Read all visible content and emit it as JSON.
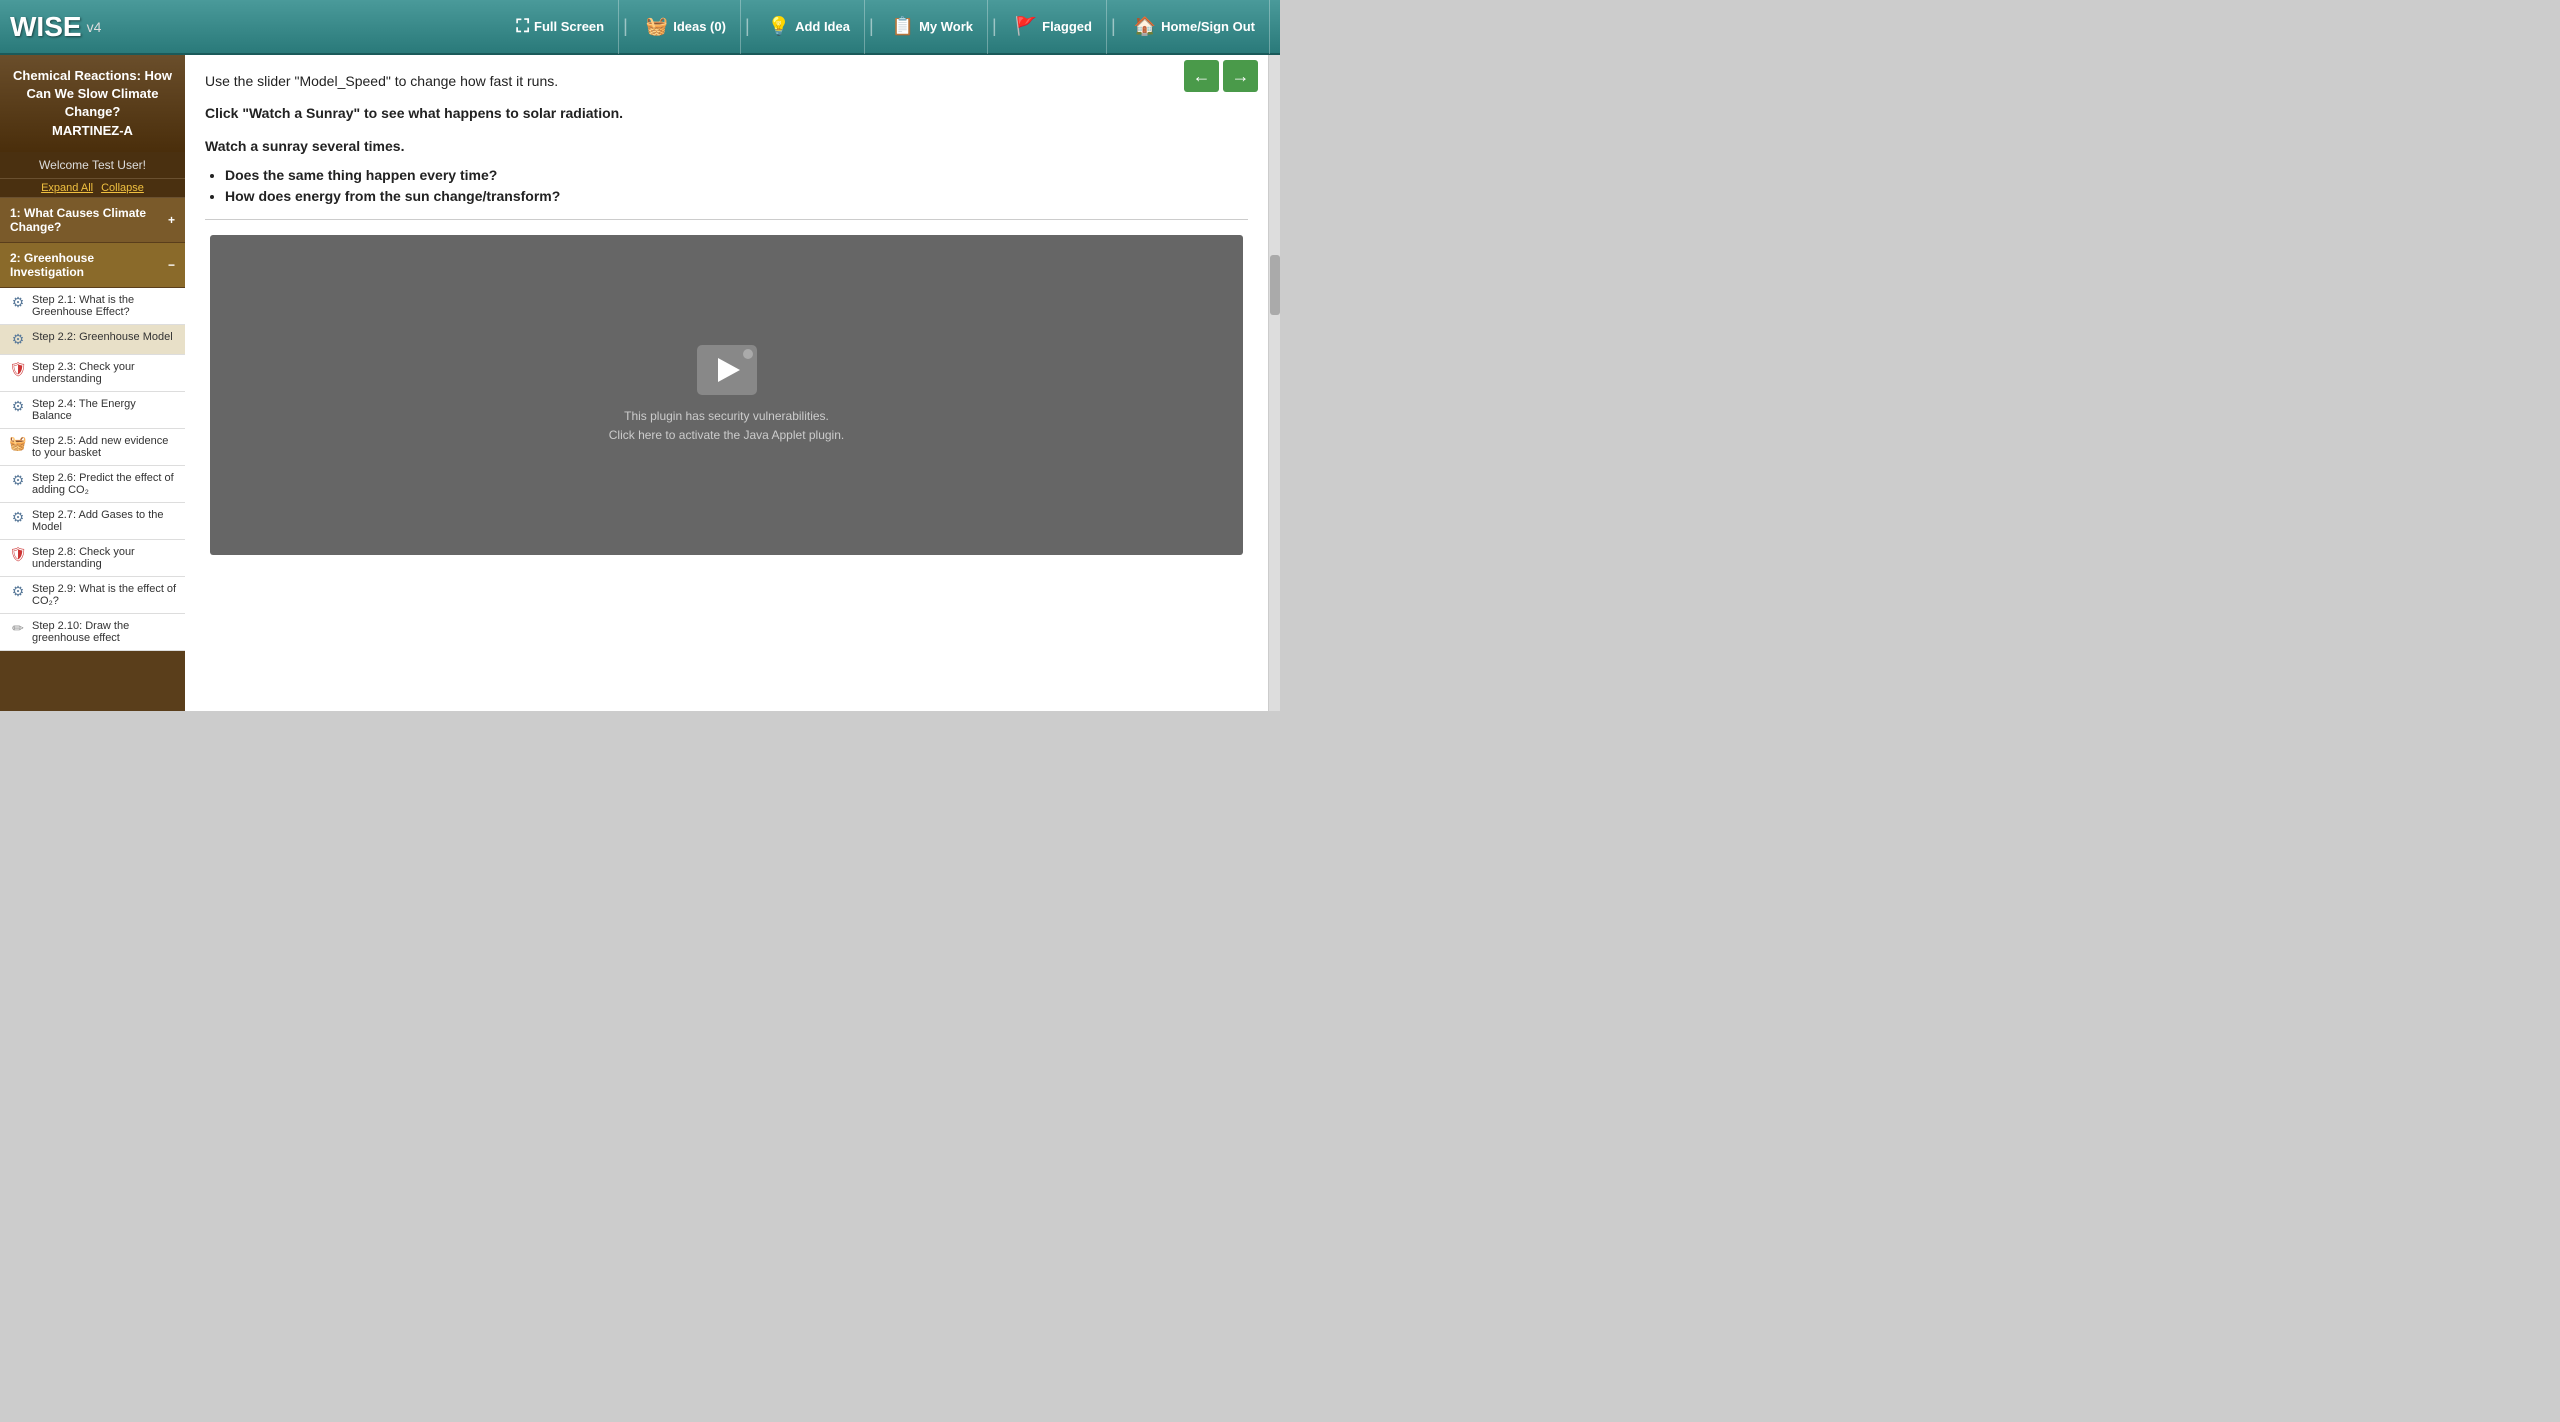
{
  "app": {
    "name": "WISE",
    "version": "v4"
  },
  "header": {
    "fullscreen_label": "Full Screen",
    "ideas_label": "Ideas (0)",
    "add_idea_label": "Add Idea",
    "my_work_label": "My Work",
    "flagged_label": "Flagged",
    "home_label": "Home",
    "sign_out_label": "Sign Out"
  },
  "sidebar": {
    "project_title": "Chemical Reactions: How Can We Slow Climate Change?",
    "class_label": "MARTINEZ-A",
    "user_label": "Welcome Test User!",
    "expand_label": "Expand All",
    "collapse_label": "Collapse",
    "sections": [
      {
        "id": "section1",
        "label": "1: What Causes Climate Change?",
        "expanded": false
      },
      {
        "id": "section2",
        "label": "2: Greenhouse Investigation",
        "expanded": true
      }
    ],
    "steps": [
      {
        "id": "step2_1",
        "label": "Step 2.1: What is the Greenhouse Effect?",
        "icon": "gear",
        "active": false
      },
      {
        "id": "step2_2",
        "label": "Step 2.2: Greenhouse Model",
        "icon": "gear",
        "active": true
      },
      {
        "id": "step2_3",
        "label": "Step 2.3: Check your understanding",
        "icon": "shield",
        "active": false
      },
      {
        "id": "step2_4",
        "label": "Step 2.4: The Energy Balance",
        "icon": "gear",
        "active": false
      },
      {
        "id": "step2_5",
        "label": "Step 2.5: Add new evidence to your basket",
        "icon": "basket",
        "active": false
      },
      {
        "id": "step2_6",
        "label": "Step 2.6: Predict the effect of adding CO₂",
        "icon": "gear",
        "active": false
      },
      {
        "id": "step2_7",
        "label": "Step 2.7: Add Gases to the Model",
        "icon": "gear",
        "active": false
      },
      {
        "id": "step2_8",
        "label": "Step 2.8: Check your understanding",
        "icon": "shield",
        "active": false
      },
      {
        "id": "step2_9",
        "label": "Step 2.9: What is the effect of CO₂?",
        "icon": "gear",
        "active": false
      },
      {
        "id": "step2_10",
        "label": "Step 2.10: Draw the greenhouse effect",
        "icon": "pencil",
        "active": false
      }
    ]
  },
  "content": {
    "text1": "Use the slider \"Model_Speed\" to change how fast it runs.",
    "text2": "Click \"Watch a Sunray\" to see what happens to solar radiation.",
    "text3": "Watch a sunray several times.",
    "bullet1": "Does the same thing happen every time?",
    "bullet2": "How does energy from the sun change/transform?",
    "plugin_line1": "This plugin has security vulnerabilities.",
    "plugin_line2": "Click here to activate the Java Applet plugin."
  }
}
